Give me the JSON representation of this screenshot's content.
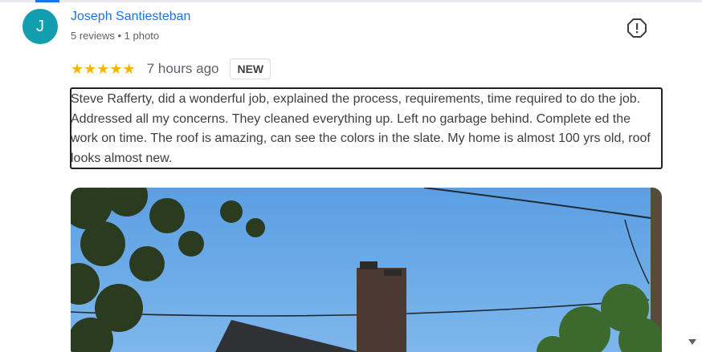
{
  "review": {
    "author": {
      "initial": "J",
      "name": "Joseph Santiesteban",
      "meta": "5 reviews • 1 photo"
    },
    "rating": 5,
    "stars_text": "★★★★★",
    "time": "7 hours ago",
    "badge": "NEW",
    "text": "Steve Rafferty, did a wonderful job, explained the process, requirements, time required to do the job. Addressed all my concerns. They cleaned everything up. Left no garbage behind. Complete ed the work on time. The roof is amazing, can see the colors in the slate. My home is almost 100 yrs old, roof looks almost new."
  },
  "icons": {
    "report": "report-icon",
    "scroll": "scroll-down-icon"
  },
  "colors": {
    "accent": "#1a73e8",
    "avatar": "#129eaf",
    "star": "#f4b400",
    "sky": "#6aa7e6"
  }
}
